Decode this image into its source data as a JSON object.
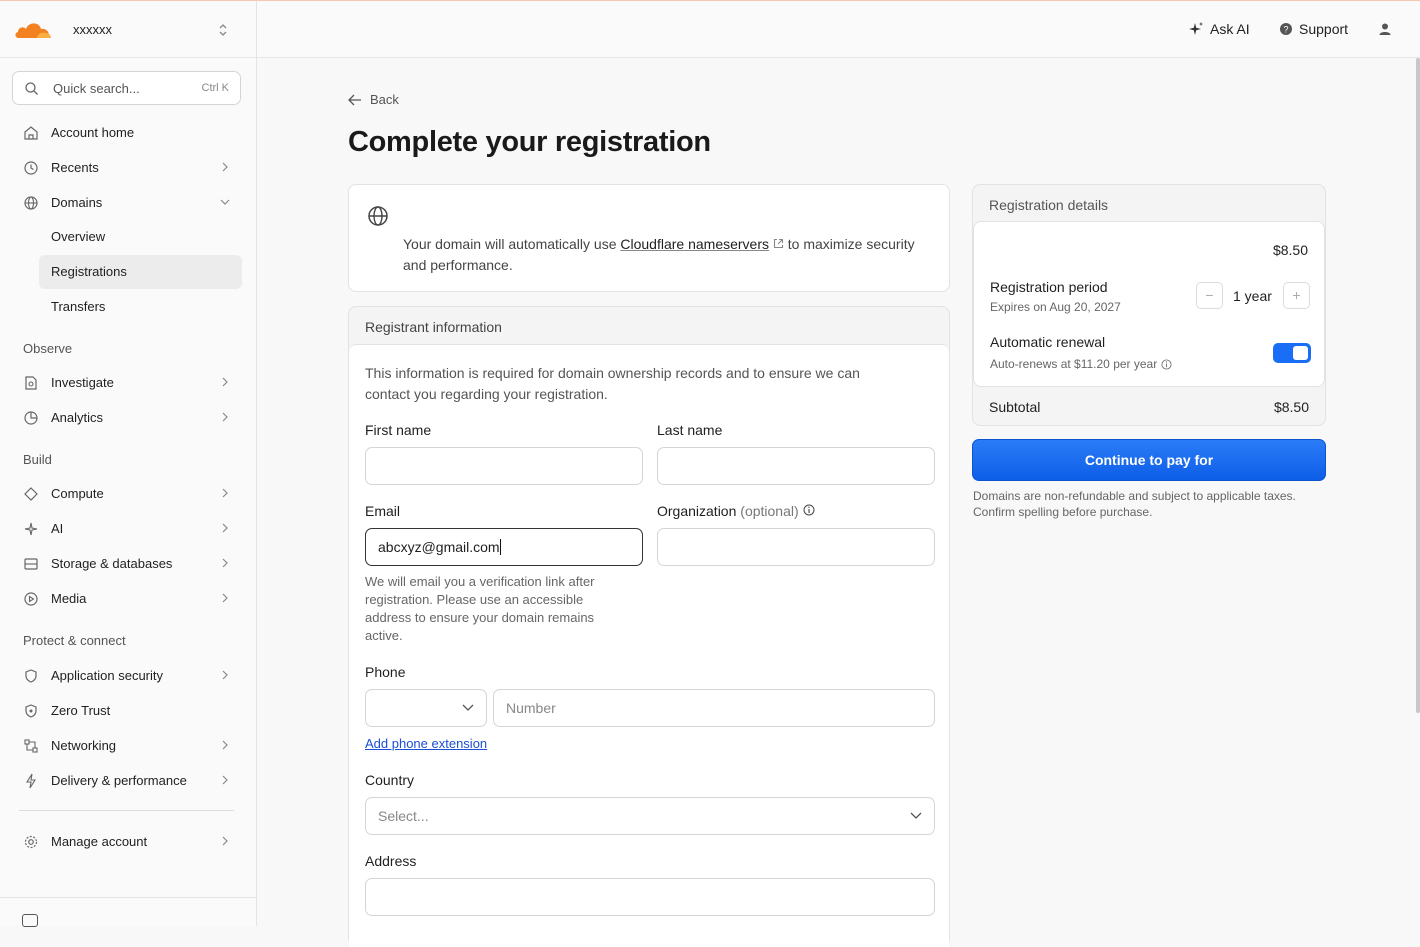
{
  "account": {
    "name": "xxxxxx"
  },
  "search": {
    "placeholder": "Quick search...",
    "shortcut": "Ctrl K"
  },
  "sidebar": {
    "items": [
      {
        "label": "Account home"
      },
      {
        "label": "Recents"
      },
      {
        "label": "Domains"
      }
    ],
    "domains_sub": [
      {
        "label": "Overview"
      },
      {
        "label": "Registrations"
      },
      {
        "label": "Transfers"
      }
    ],
    "observe": {
      "heading": "Observe",
      "items": [
        {
          "label": "Investigate"
        },
        {
          "label": "Analytics"
        }
      ]
    },
    "build": {
      "heading": "Build",
      "items": [
        {
          "label": "Compute"
        },
        {
          "label": "AI"
        },
        {
          "label": "Storage & databases"
        },
        {
          "label": "Media"
        }
      ]
    },
    "protect": {
      "heading": "Protect & connect",
      "items": [
        {
          "label": "Application security"
        },
        {
          "label": "Zero Trust"
        },
        {
          "label": "Networking"
        },
        {
          "label": "Delivery & performance"
        }
      ]
    },
    "manage": {
      "label": "Manage account"
    }
  },
  "header": {
    "ask_ai": "Ask AI",
    "support": "Support"
  },
  "page": {
    "back": "Back",
    "title": "Complete your registration",
    "nameserver_note_pre": "Your domain will automatically use ",
    "nameserver_link": "Cloudflare nameservers",
    "nameserver_note_post": " to maximize security and performance."
  },
  "registrant": {
    "heading": "Registrant information",
    "info": "This information is required for domain ownership records and to ensure we can contact you regarding your registration.",
    "first_name_label": "First name",
    "last_name_label": "Last name",
    "email_label": "Email",
    "email_value": "abcxyz@gmail.com",
    "org_label": "Organization",
    "org_optional": "(optional)",
    "email_help": "We will email you a verification link after registration. Please use an accessible address to ensure your domain remains active.",
    "phone_label": "Phone",
    "phone_placeholder": "Number",
    "phone_ext": "Add phone extension",
    "country_label": "Country",
    "country_placeholder": "Select...",
    "address_label": "Address"
  },
  "details": {
    "heading": "Registration details",
    "price": "$8.50",
    "period_label": "Registration period",
    "expires": "Expires on Aug 20, 2027",
    "period_value": "1 year",
    "renewal_label": "Automatic renewal",
    "renewal_sub": "Auto-renews at $11.20 per year",
    "renewal_on": true,
    "subtotal_label": "Subtotal",
    "subtotal_value": "$8.50",
    "pay_button": "Continue to pay for",
    "disclaimer": "Domains are non-refundable and subject to applicable taxes. Confirm spelling before purchase."
  },
  "colors": {
    "accent": "#1a6ef5",
    "brand_orange": "#f48120"
  }
}
